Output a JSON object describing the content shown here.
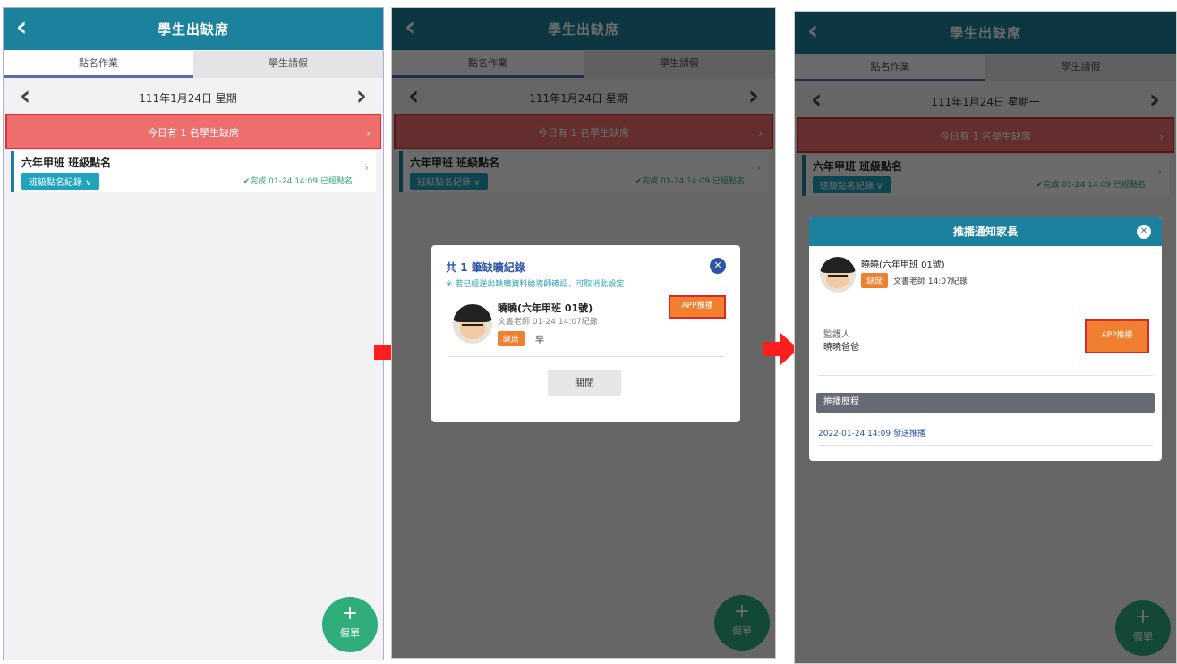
{
  "header": {
    "back_icon": "chevron-left-icon",
    "title": "學生出缺席"
  },
  "tabs": [
    "點名作業",
    "學生請假"
  ],
  "date_nav": {
    "prev": "‹",
    "date": "111年1月24日 星期一",
    "next": "›"
  },
  "alert": {
    "text": "今日有 1 名學生缺席",
    "chevron": "›"
  },
  "record": {
    "class_name": "六年甲班 班級點名",
    "tag": "班級點名紀錄 ∨",
    "status": "✔完成 01-24 14:09 已經點名",
    "chevron": "›"
  },
  "fab": {
    "plus": "+",
    "label": "假單"
  },
  "modal_list": {
    "title": "共 1 筆缺曠紀錄",
    "note": "※ 若已經送出缺曠資料給導師確認，可取消此設定",
    "close_icon": "close-icon",
    "student_name": "曉曉(六年甲班 01號)",
    "recorder": "文書老師 01-24 14:07紀錄",
    "badge": "缺席",
    "badge_value": "早",
    "app_button": "APP推播",
    "close_button": "關閉"
  },
  "modal_notify": {
    "title": "推播通知家長",
    "close_icon": "close-icon",
    "student_name": "曉曉(六年甲班 01號)",
    "badge": "缺席",
    "recorder": "文書老師 14:07紀錄",
    "receiver_label": "監護人",
    "receiver_name": "曉曉爸爸",
    "app_button": "APP推播",
    "section_title": "推播歷程",
    "log_time": "2022-01-24 14:09",
    "log_text": "發送推播"
  },
  "colors": {
    "header": "#1b819d",
    "alert": "#ee6e6e",
    "accent_orange": "#f08030",
    "fab": "#2fae7c",
    "arrow": "#ff1e1e"
  }
}
